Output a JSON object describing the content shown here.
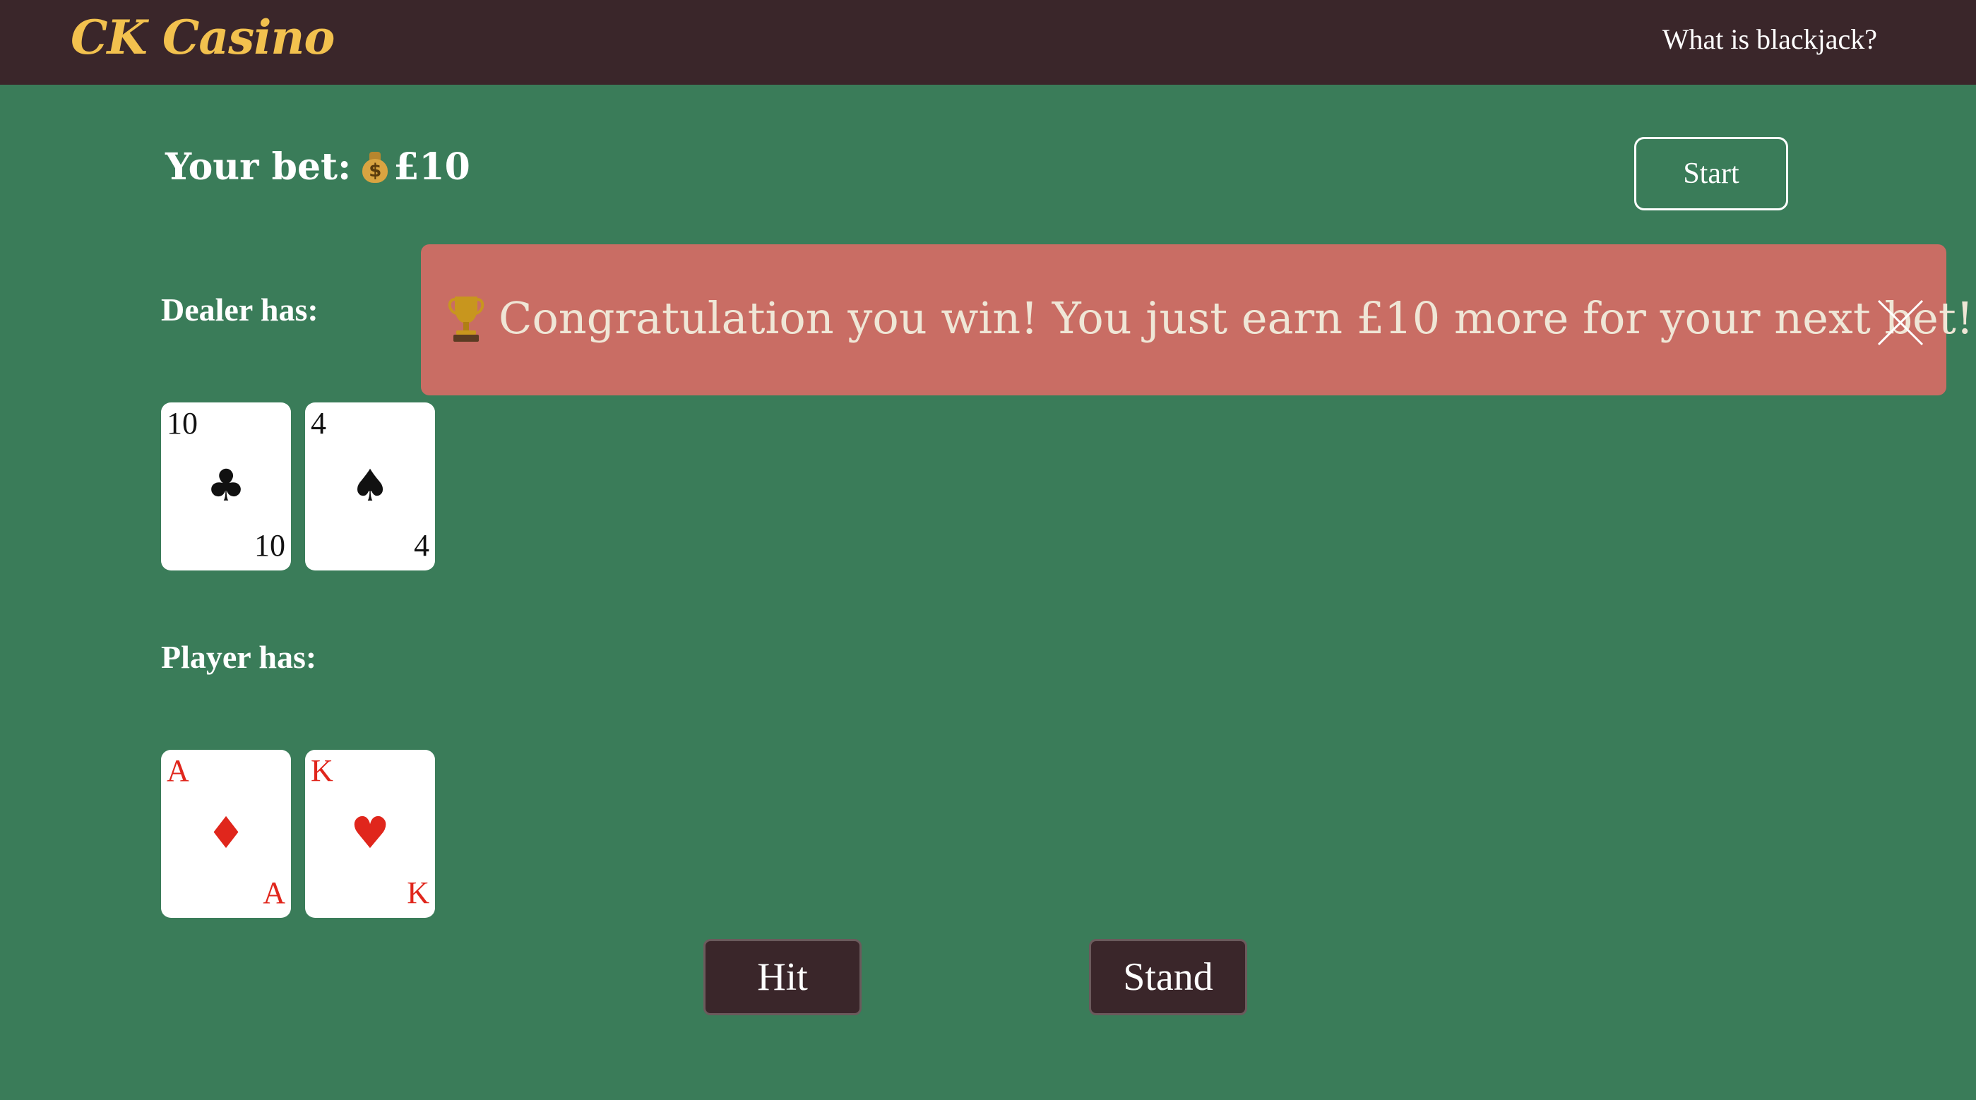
{
  "header": {
    "logo": "CK Casino",
    "nav_link": "What is blackjack?"
  },
  "bet": {
    "label": "Your bet:",
    "icon": "money-bag-icon",
    "icon_symbol": "$",
    "amount": "£10"
  },
  "controls": {
    "start_label": "Start",
    "hit_label": "Hit",
    "stand_label": "Stand"
  },
  "alert": {
    "icon": "trophy-icon",
    "message": "Congratulation you win! You just earn £10 more for your next bet!",
    "close_icon": "close-icon"
  },
  "dealer": {
    "label": "Dealer has:",
    "cards": [
      {
        "rank": "10",
        "suit": "♣",
        "color": "black"
      },
      {
        "rank": "4",
        "suit": "♠",
        "color": "black"
      }
    ]
  },
  "player": {
    "label": "Player has:",
    "cards": [
      {
        "rank": "A",
        "suit": "♦",
        "color": "red"
      },
      {
        "rank": "K",
        "suit": "♥",
        "color": "red"
      }
    ]
  },
  "colors": {
    "table_green": "#3a7c59",
    "navbar": "#3a262a",
    "logo_gold": "#f2c14e",
    "alert_bg": "#c96d64",
    "alert_text": "#efe6d6",
    "card_red": "#e0261c"
  }
}
